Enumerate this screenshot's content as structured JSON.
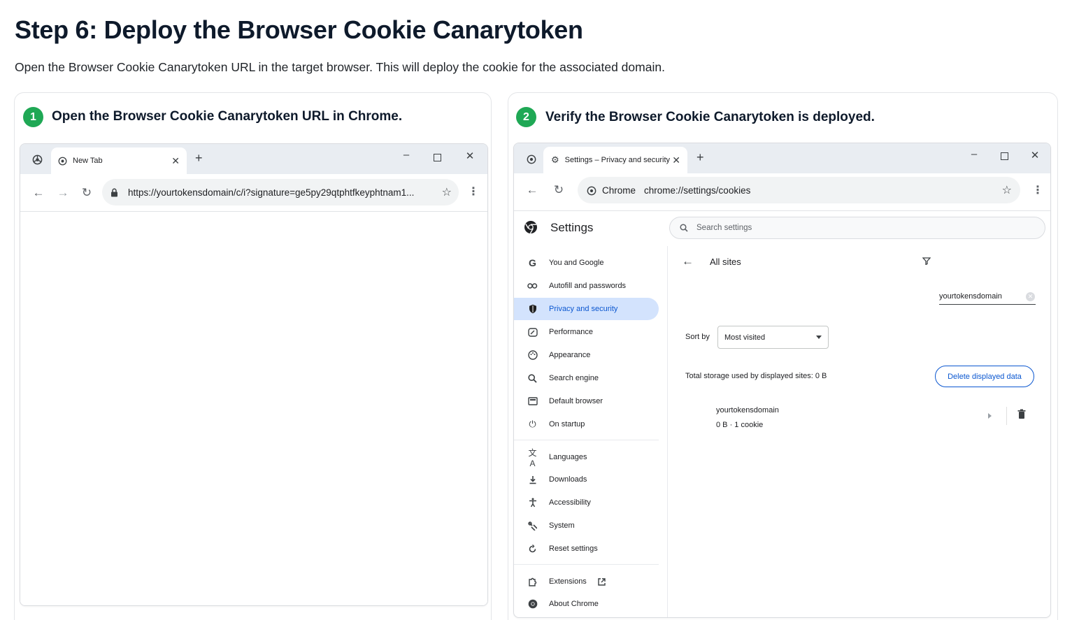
{
  "page": {
    "title": "Step 6: Deploy the Browser Cookie Canarytoken",
    "description": "Open the Browser Cookie Canarytoken URL in the target browser. This will deploy the cookie for the associated domain."
  },
  "step1": {
    "number": "1",
    "title": "Open the Browser Cookie Canarytoken URL in Chrome.",
    "tab_title": "New Tab",
    "url": "https://yourtokensdomain/c/i?signature=ge5py29qtphtfkeyphtnam1..."
  },
  "step2": {
    "number": "2",
    "title": "Verify the Browser Cookie Canarytoken is deployed.",
    "tab_title": "Settings – Privacy and security",
    "omnibox_label": "Chrome",
    "omnibox_url": "chrome://settings/cookies",
    "settings_title": "Settings",
    "search_placeholder": "Search settings",
    "sidebar": [
      {
        "label": "You and Google",
        "icon": "google-g-icon"
      },
      {
        "label": "Autofill and passwords",
        "icon": "key-icon"
      },
      {
        "label": "Privacy and security",
        "icon": "shield-icon",
        "active": true
      },
      {
        "label": "Performance",
        "icon": "speedometer-icon"
      },
      {
        "label": "Appearance",
        "icon": "palette-icon"
      },
      {
        "label": "Search engine",
        "icon": "search-icon"
      },
      {
        "label": "Default browser",
        "icon": "browser-window-icon"
      },
      {
        "label": "On startup",
        "icon": "power-icon"
      },
      {
        "label": "Languages",
        "icon": "translate-icon"
      },
      {
        "label": "Downloads",
        "icon": "download-icon"
      },
      {
        "label": "Accessibility",
        "icon": "accessibility-icon"
      },
      {
        "label": "System",
        "icon": "wrench-icon"
      },
      {
        "label": "Reset settings",
        "icon": "reset-icon"
      },
      {
        "label": "Extensions",
        "icon": "puzzle-icon"
      },
      {
        "label": "About Chrome",
        "icon": "chrome-icon"
      }
    ],
    "all_sites_label": "All sites",
    "filter_value": "yourtokensdomain",
    "sort_by_label": "Sort by",
    "sort_value": "Most visited",
    "storage_text": "Total storage used by displayed sites: 0 B",
    "delete_button": "Delete displayed data",
    "site": {
      "name": "yourtokensdomain",
      "detail": "0 B · 1 cookie"
    }
  }
}
